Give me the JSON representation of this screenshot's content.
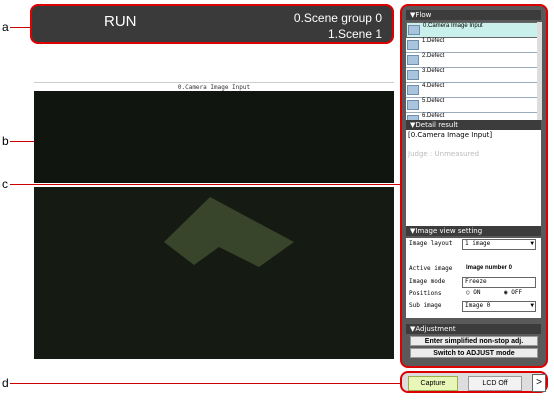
{
  "callouts": {
    "a": "a",
    "b": "b",
    "c": "c",
    "d": "d"
  },
  "header": {
    "mode": "RUN",
    "scene_group": "0.Scene group 0",
    "scene": "1.Scene 1"
  },
  "image": {
    "title": "0.Camera Image Input"
  },
  "flow": {
    "title": "▼Flow",
    "items": [
      {
        "label": "0.Camera Image Input"
      },
      {
        "label": "1.Defect"
      },
      {
        "label": "2.Defect"
      },
      {
        "label": "3.Defect"
      },
      {
        "label": "4.Defect"
      },
      {
        "label": "5.Defect"
      },
      {
        "label": "6.Defect"
      }
    ]
  },
  "detail": {
    "title": "▼Detail result",
    "line1": "[0.Camera Image Input]",
    "line2": "Judge : Unmeasured"
  },
  "image_view": {
    "title": "▼Image view setting",
    "image_layout_label": "Image layout",
    "image_layout_value": "1 image",
    "active_image_label": "Active image",
    "active_image_value": "Image number 0",
    "image_mode_label": "Image mode",
    "image_mode_value": "Freeze",
    "positions_label": "Positions",
    "positions_on": "ON",
    "positions_off": "OFF",
    "sub_image_label": "Sub image",
    "sub_image_value": "Image 0"
  },
  "adjustment": {
    "title": "▼Adjustment",
    "btn1": "Enter simplified non-stop adj.",
    "btn2": "Switch to ADJUST mode"
  },
  "bottom": {
    "capture": "Capture",
    "lcd": "LCD Off",
    "arrow": ">"
  },
  "colors": {
    "callout_line": "#cc0000",
    "header_bg": "#3a3a3a",
    "panel_bg": "#5a5a5a"
  }
}
